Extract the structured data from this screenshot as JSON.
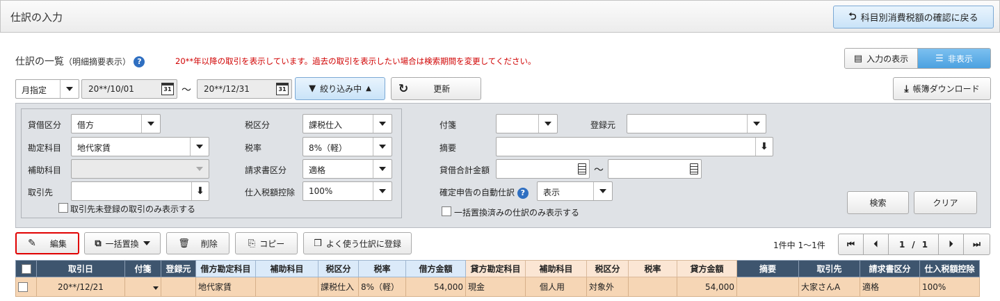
{
  "page": {
    "title": "仕訳の入力",
    "back_button": "科目別消費税額の確認に戻る"
  },
  "list_header": {
    "title": "仕訳の一覧",
    "subtitle": "（明細摘要表示）",
    "notice": "20**年以降の取引を表示しています。過去の取引を表示したい場合は検索期間を変更してください。",
    "view_toggle": {
      "show_input": "入力の表示",
      "hide": "非表示"
    }
  },
  "period": {
    "mode": "月指定",
    "from": "20**/10/01",
    "to": "20**/12/31",
    "separator": "～",
    "calendar_day": "31",
    "filter_button": "絞り込み中",
    "refresh_button": "更新",
    "download_button": "帳簿ダウンロード"
  },
  "filters": {
    "debit_credit": {
      "label": "貸借区分",
      "value": "借方"
    },
    "account": {
      "label": "勘定科目",
      "value": "地代家賃"
    },
    "sub_account": {
      "label": "補助科目",
      "value": ""
    },
    "partner": {
      "label": "取引先",
      "value": ""
    },
    "partner_unregistered": "取引先未登録の取引のみ表示する",
    "tax_category": {
      "label": "税区分",
      "value": "課税仕入"
    },
    "tax_rate": {
      "label": "税率",
      "value": "8%（軽）"
    },
    "invoice_category": {
      "label": "請求書区分",
      "value": "適格"
    },
    "input_tax_deduction": {
      "label": "仕入税額控除",
      "value": "100%"
    },
    "tag": {
      "label": "付箋",
      "value": ""
    },
    "registered_from": {
      "label": "登録元",
      "value": ""
    },
    "description": {
      "label": "摘要",
      "value": ""
    },
    "amount": {
      "label": "貸借合計金額",
      "from": "",
      "to": "",
      "separator": "～"
    },
    "auto_entry": {
      "label": "確定申告の自動仕訳",
      "value": "表示"
    },
    "bulk_replaced_only": "一括置換済みの仕訳のみ表示する",
    "search_button": "検索",
    "clear_button": "クリア"
  },
  "toolbar": {
    "edit": "編集",
    "bulk_replace": "一括置換",
    "delete": "削除",
    "copy": "コピー",
    "register_favorite": "よく使う仕訳に登録"
  },
  "pagination": {
    "count": "1件中 1～1件",
    "current": "1",
    "sep": "/",
    "total": "1"
  },
  "table": {
    "headers": [
      "",
      "取引日",
      "付箋",
      "登録元",
      "借方勘定科目",
      "補助科目",
      "税区分",
      "税率",
      "借方金額",
      "貸方勘定科目",
      "補助科目",
      "税区分",
      "税率",
      "貸方金額",
      "摘要",
      "取引先",
      "請求書区分",
      "仕入税額控除"
    ],
    "rows": [
      [
        "",
        "20**/12/21",
        "",
        "",
        "地代家賃",
        "",
        "課税仕入",
        "8%（軽）",
        "54,000",
        "現金",
        "個人用",
        "対象外",
        "",
        "54,000",
        "",
        "大家さんA",
        "適格",
        "100%"
      ]
    ]
  }
}
